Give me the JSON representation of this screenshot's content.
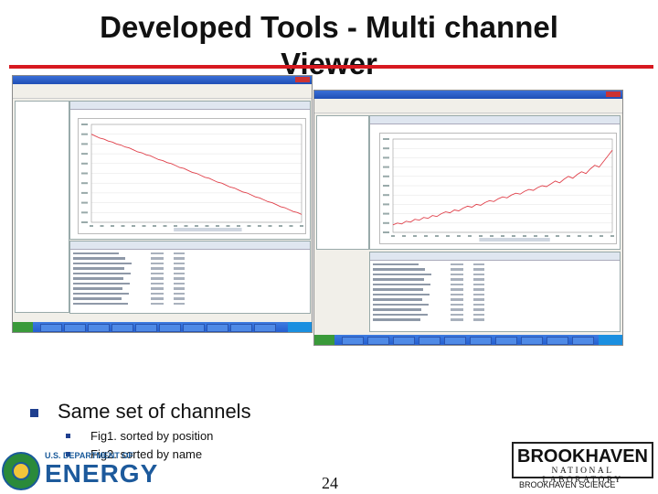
{
  "slide": {
    "title_line1": "Developed Tools - Multi channel",
    "title_line2": "Viewer",
    "bullet_main": "Same set of channels",
    "sub1": "Fig1. sorted by position",
    "sub2": "Fig2. sorted by name",
    "page_number": "24",
    "doe_small": "U.S. DEPARTMENT OF",
    "doe_energy": "ENERGY",
    "bnl_name": "BROOKHAVEN",
    "bnl_lab": "NATIONAL LABORATORY",
    "bnl_science": "BROOKHAVEN SCIENCE"
  },
  "colors": {
    "accent_red": "#d71920",
    "bullet_blue": "#1f3f8f",
    "doe_blue": "#1d5a9c",
    "plot_line": "#e0404a"
  },
  "fig1": {
    "trend": "descending",
    "series": [
      0.9,
      0.88,
      0.86,
      0.85,
      0.83,
      0.82,
      0.8,
      0.79,
      0.77,
      0.76,
      0.74,
      0.72,
      0.71,
      0.69,
      0.68,
      0.66,
      0.64,
      0.63,
      0.61,
      0.6,
      0.58,
      0.56,
      0.55,
      0.53,
      0.51,
      0.5,
      0.48,
      0.46,
      0.45,
      0.43,
      0.41,
      0.4,
      0.38,
      0.36,
      0.35,
      0.33,
      0.31,
      0.3,
      0.28,
      0.26,
      0.25,
      0.23,
      0.21,
      0.2,
      0.18,
      0.16,
      0.15,
      0.13,
      0.11,
      0.1,
      0.08
    ]
  },
  "fig2": {
    "trend": "ascending",
    "series": [
      0.08,
      0.1,
      0.09,
      0.12,
      0.11,
      0.14,
      0.13,
      0.16,
      0.15,
      0.18,
      0.17,
      0.2,
      0.22,
      0.21,
      0.24,
      0.23,
      0.26,
      0.28,
      0.27,
      0.3,
      0.29,
      0.32,
      0.34,
      0.33,
      0.36,
      0.38,
      0.37,
      0.4,
      0.42,
      0.41,
      0.44,
      0.46,
      0.45,
      0.48,
      0.5,
      0.49,
      0.52,
      0.55,
      0.53,
      0.57,
      0.6,
      0.58,
      0.62,
      0.65,
      0.63,
      0.68,
      0.72,
      0.7,
      0.76,
      0.82,
      0.88
    ]
  }
}
